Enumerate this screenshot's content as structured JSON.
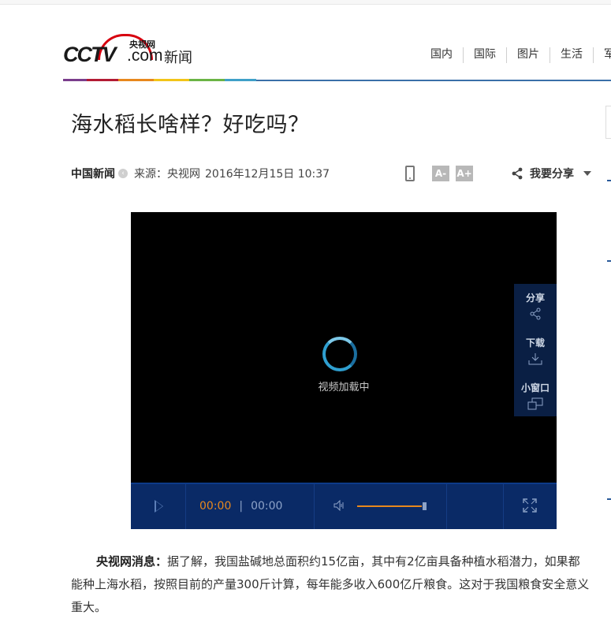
{
  "header": {
    "logo_cctv": "CCTV",
    "logo_com": ".com",
    "logo_yangshi": "央视网",
    "logo_xinwen": "新闻",
    "nav": [
      "国内",
      "国际",
      "图片",
      "生活",
      "军"
    ]
  },
  "article": {
    "title": "海水稻长啥样？好吃吗？",
    "source_name": "中国新闻",
    "source_label": "来源：央视网",
    "date": "2016年12月15日 10:37",
    "font_smaller": "A-",
    "font_larger": "A+",
    "share_label": "我要分享",
    "paragraph_lead": "央视网消息：",
    "paragraph_text": "据了解，我国盐碱地总面积约15亿亩，其中有2亿亩具备种植水稻潜力，如果都能种上海水稻，按照目前的产量300斤计算，每年能多收入600亿斤粮食。这对于我国粮食安全意义重大。"
  },
  "player": {
    "loading_text": "视频加载中",
    "side": {
      "share": "分享",
      "download": "下载",
      "mini": "小窗口"
    },
    "current_time": "00:00",
    "separator": "|",
    "total_time": "00:00",
    "volume_level": 0.95
  },
  "colors": {
    "accent_blue": "#3a6fa8",
    "player_bar": "#0a2a66",
    "time_orange": "#e8881d",
    "logo_red": "#d7000f"
  }
}
